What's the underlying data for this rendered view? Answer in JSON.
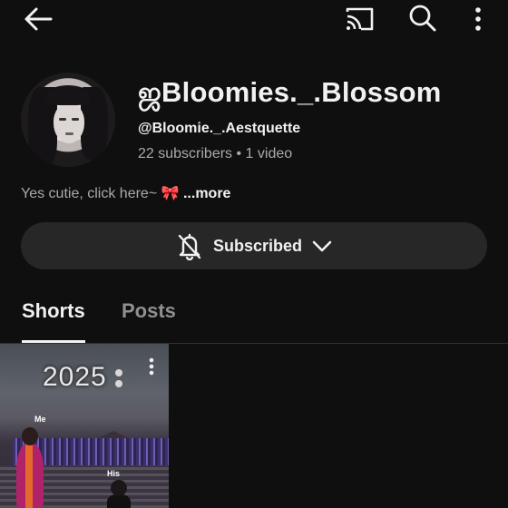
{
  "channel": {
    "name": "ஜBloomies._.Blossom",
    "handle": "@Bloomie._.Aestquette",
    "stats": "22 subscribers • 1 video",
    "description": "Yes cutie, click here~ 🎀",
    "description_more": "...more"
  },
  "subscribe_button": {
    "label": "Subscribed"
  },
  "tabs": [
    {
      "label": "Shorts",
      "active": true
    },
    {
      "label": "Posts",
      "active": false
    }
  ],
  "short": {
    "overlay_year": "2025",
    "label_left": "Me",
    "label_right": "His"
  },
  "icons": {
    "back": "arrow-left-icon",
    "cast": "cast-icon",
    "search": "search-icon",
    "more": "more-vert-icon",
    "bell": "bell-off-icon",
    "chevron": "chevron-down-icon"
  },
  "colors": {
    "background": "#0f0f0f",
    "button_bg": "#272727",
    "text_primary": "#f1f1f1",
    "text_secondary": "#aaaaaa"
  }
}
